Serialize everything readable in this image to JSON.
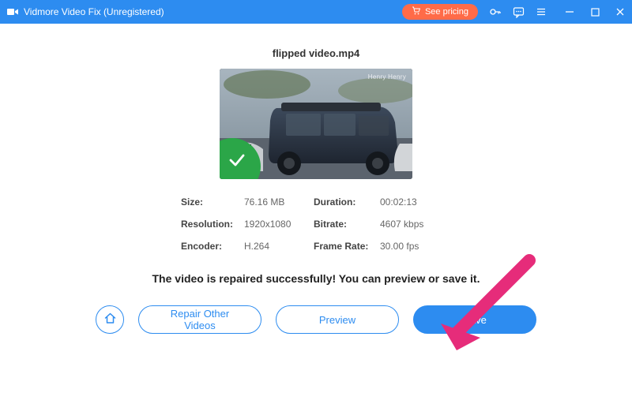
{
  "titlebar": {
    "app_name": "Vidmore Video Fix (Unregistered)",
    "pricing_label": "See pricing"
  },
  "file": {
    "name": "flipped video.mp4",
    "watermark": "Henry    Henry"
  },
  "info": {
    "size_label": "Size:",
    "size_val": "76.16 MB",
    "duration_label": "Duration:",
    "duration_val": "00:02:13",
    "resolution_label": "Resolution:",
    "resolution_val": "1920x1080",
    "bitrate_label": "Bitrate:",
    "bitrate_val": "4607 kbps",
    "encoder_label": "Encoder:",
    "encoder_val": "H.264",
    "framerate_label": "Frame Rate:",
    "framerate_val": "30.00 fps"
  },
  "message": "The video is repaired successfully! You can preview or save it.",
  "buttons": {
    "repair_other": "Repair Other Videos",
    "preview": "Preview",
    "save": "Save"
  },
  "colors": {
    "accent": "#2d8cf0",
    "pricing": "#ff6b48",
    "success": "#2ba648",
    "annotation": "#e62c7a"
  }
}
